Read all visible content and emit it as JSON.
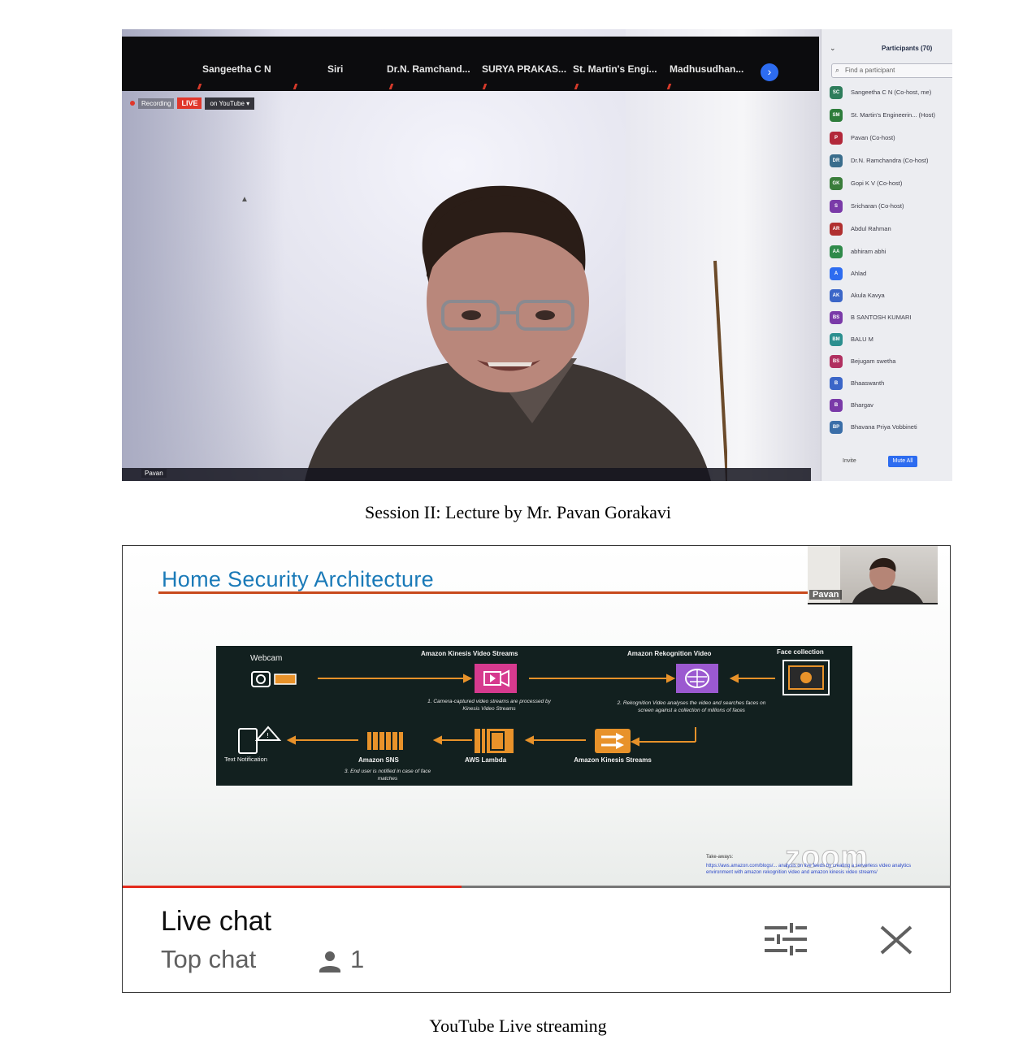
{
  "zoom": {
    "strip_names": [
      "Sangeetha C N",
      "Siri",
      "Dr.N. Ramchand...",
      "SURYA PRAKAS...",
      "St. Martin's Engi...",
      "Madhusudhan..."
    ],
    "recording_label": "Recording",
    "live_label": "LIVE",
    "live_destination": "on YouTube",
    "video_name_tag": "Pavan",
    "participants": {
      "title": "Participants (70)",
      "search_placeholder": "Find a participant",
      "list": [
        {
          "initials": "SC",
          "name": "Sangeetha C N (Co-host, me)",
          "color": "#2e7d5b"
        },
        {
          "initials": "SM",
          "name": "St. Martin's Engineerin... (Host)",
          "color": "#2e7d3b"
        },
        {
          "initials": "P",
          "name": "Pavan (Co-host)",
          "color": "#b2283a"
        },
        {
          "initials": "DR",
          "name": "Dr.N. Ramchandra (Co-host)",
          "color": "#3a6d8c"
        },
        {
          "initials": "GK",
          "name": "Gopi K V (Co-host)",
          "color": "#3a7d3b"
        },
        {
          "initials": "S",
          "name": "Sricharan (Co-host)",
          "color": "#7a3aa8"
        },
        {
          "initials": "AR",
          "name": "Abdul Rahman",
          "color": "#b03030"
        },
        {
          "initials": "AA",
          "name": "abhiram abhi",
          "color": "#2f8a4a"
        },
        {
          "initials": "A",
          "name": "Ahlad",
          "color": "#2d6cf0"
        },
        {
          "initials": "AK",
          "name": "Akula Kavya",
          "color": "#3b66c8"
        },
        {
          "initials": "BS",
          "name": "B SANTOSH KUMARI",
          "color": "#7a3aa8"
        },
        {
          "initials": "BM",
          "name": "BALU M",
          "color": "#2c8f8f"
        },
        {
          "initials": "BS",
          "name": "Bejugam swetha",
          "color": "#b03060"
        },
        {
          "initials": "B",
          "name": "Bhaaswanth",
          "color": "#3b66c8"
        },
        {
          "initials": "B",
          "name": "Bhargav",
          "color": "#7a3aa8"
        },
        {
          "initials": "BP",
          "name": "Bhavana Priya Vobbineti",
          "color": "#3a6ea8"
        }
      ],
      "invite_label": "Invite",
      "mute_all_label": "Mute All"
    }
  },
  "caption_top": "Session II: Lecture by Mr. Pavan Gorakavi",
  "youtube": {
    "slide": {
      "title": "Home Security Architecture",
      "pip_name": "Pavan",
      "diagram": {
        "webcam": "Webcam",
        "kvs": "Amazon Kinesis Video Streams",
        "rekognition": "Amazon Rekognition Video",
        "face_collection": "Face collection",
        "note1": "1. Camera-captured video streams are processed by Kinesis Video Streams",
        "note2": "2. Rekognition Video analyses the video and searches faces on screen against a collection of millions of faces",
        "text_notification": "Text Notification",
        "sns": "Amazon SNS",
        "lambda": "AWS Lambda",
        "kinesis_streams": "Amazon Kinesis Streams",
        "note3": "3. End user is notified in case of face matches"
      },
      "watermark": "zoom",
      "ref_head": "Take-aways:",
      "ref_text": "https://aws.amazon.com/blogs/... analysis on live feeds by creating a serverless video analytics environment with amazon rekognition video and amazon kinesis video streams/"
    },
    "progress_fraction": 0.41,
    "chat": {
      "title": "Live chat",
      "subtitle": "Top chat",
      "viewers": "1"
    }
  },
  "caption_bottom": "YouTube Live streaming"
}
